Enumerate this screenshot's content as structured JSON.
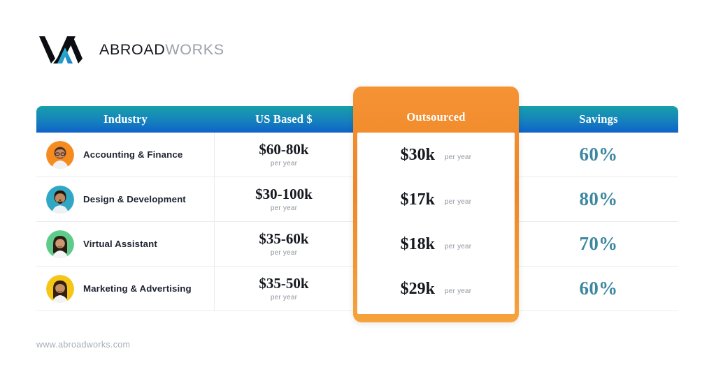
{
  "brand": {
    "name_part1": "ABROAD",
    "name_part2": "WORKS",
    "logo_icon": "abroadworks-vav-logo",
    "colors": {
      "dark": "#14161d",
      "gray": "#9aa1ab",
      "teal": "#17a0a8",
      "blue": "#0f62c8",
      "orange": "#ef8527",
      "savings_text": "#3d87a0"
    }
  },
  "table": {
    "headers": {
      "industry": "Industry",
      "us_based": "US Based $",
      "outsourced": "Outsourced",
      "savings": "Savings"
    },
    "per_year_label": "per year",
    "rows": [
      {
        "industry": "Accounting & Finance",
        "avatar_icon": "avatar-accounting-finance",
        "avatar_color": "#F68B1F",
        "us_based": "$60-80k",
        "outsourced": "$30k",
        "savings": "60%"
      },
      {
        "industry": "Design & Development",
        "avatar_icon": "avatar-design-development",
        "avatar_color": "#30A7C4",
        "us_based": "$30-100k",
        "outsourced": "$17k",
        "savings": "80%"
      },
      {
        "industry": "Virtual Assistant",
        "avatar_icon": "avatar-virtual-assistant",
        "avatar_color": "#5ECB8A",
        "us_based": "$35-60k",
        "outsourced": "$18k",
        "savings": "70%"
      },
      {
        "industry": "Marketing & Advertising",
        "avatar_icon": "avatar-marketing-advertising",
        "avatar_color": "#F5C518",
        "us_based": "$35-50k",
        "outsourced": "$29k",
        "savings": "60%"
      }
    ]
  },
  "footer": {
    "website": "www.abroadworks.com"
  }
}
